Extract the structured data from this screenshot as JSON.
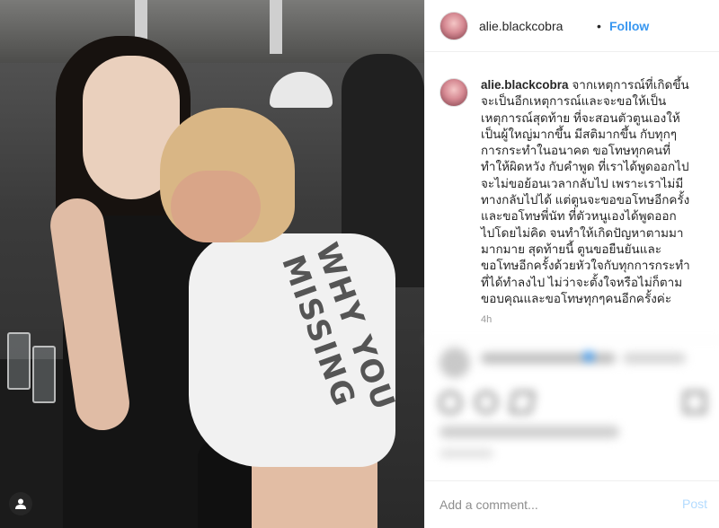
{
  "post": {
    "username": "alie.blackcobra",
    "separator": "•",
    "follow_label": "Follow",
    "more_icon": "more-horizontal-icon",
    "caption_username": "alie.blackcobra",
    "caption_text": "จากเหตุการณ์ที่เกิดขึ้น\nจะเป็นอีกเหตุการณ์และจะขอให้เป็น\nเหตุการณ์สุดท้าย ที่จะสอนตัวตูนเองให้\nเป็นผู้ใหญ่มากขึ้น มีสติมากขึ้น กับทุกๆ\nการกระทำในอนาคต ขอโทษทุกคนที่\nทำให้ผิดหวัง กับคำพูด ที่เราได้พูดออกไป\nจะไม่ขอย้อนเวลากลับไป เพราะเราไม่มี\nทางกลับไปได้ แต่ตูนจะขอขอโทษอีกครั้ง\nและขอโทษพี่นัท ที่ตัวหนูเองได้พูดออก\nไปโดยไม่คิด จนทำให้เกิดปัญหาตามมา\nมากมาย สุดท้ายนี้ ตูนขอยืนยันและ\nขอโทษอีกครั้งด้วยหัวใจกับทุกการกระทำ\nที่ได้ทำลงไป ไม่ว่าจะตั้งใจหรือไม่ก็ตาม\nขอบคุณและขอโทษทุกๆคนอีกครั้งค่ะ",
    "time_ago": "4h"
  },
  "photo": {
    "print_text": "WHY YOU\nMISSING"
  },
  "comment_box": {
    "placeholder": "Add a comment...",
    "post_label": "Post"
  },
  "colors": {
    "accent": "#3897f0",
    "post_disabled": "#b3dbff",
    "text": "#262626",
    "muted": "#999999"
  }
}
